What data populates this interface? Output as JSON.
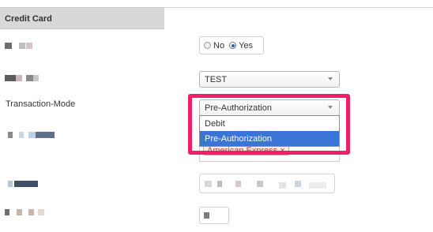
{
  "section": {
    "title": "Credit Card"
  },
  "toggle": {
    "no_label": "No",
    "yes_label": "Yes",
    "selected": "Yes"
  },
  "test_select": {
    "value": "TEST"
  },
  "transaction_mode": {
    "label": "Transaction-Mode",
    "value": "Pre-Authorization",
    "options": [
      "Debit",
      "Pre-Authorization"
    ],
    "highlighted_option": "Pre-Authorization"
  },
  "card_type": {
    "tag": "American Express ×"
  },
  "colors": {
    "highlight_frame": "#f01f68",
    "selected_option": "#3a74d4",
    "header_bg": "#d8d8d8"
  },
  "icons": {
    "select_caret": "chevron-down-icon",
    "radio": "radio-icon"
  }
}
